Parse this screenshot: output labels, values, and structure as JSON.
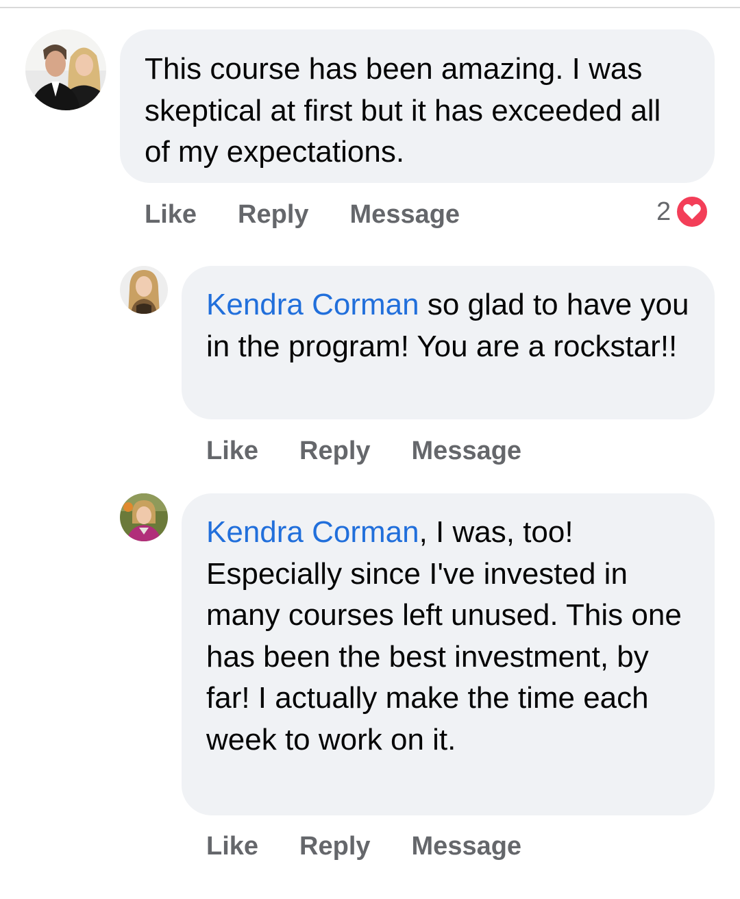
{
  "comments": [
    {
      "author": "",
      "text": "This course has been amazing. I was skeptical at first but it has exceeded all of my expectations.",
      "actions": {
        "like": "Like",
        "reply": "Reply",
        "message": "Message"
      },
      "reaction_count": "2",
      "reaction_icon": "heart-icon",
      "colors": {
        "reaction": "#f33e58"
      }
    },
    {
      "author": "Kendra Corman",
      "text": " so glad to have you in the program!  You are a rockstar!!",
      "actions": {
        "like": "Like",
        "reply": "Reply",
        "message": "Message"
      }
    },
    {
      "author": "Kendra Corman",
      "text": ", I was, too! Especially since I've invested in many courses left unused. This one has been the best investment, by far! I actually make the time each week to work on it.",
      "actions": {
        "like": "Like",
        "reply": "Reply",
        "message": "Message"
      }
    }
  ],
  "colors": {
    "bubble_bg": "#f0f2f5",
    "mention": "#216fdb",
    "action_text": "#65676b"
  }
}
